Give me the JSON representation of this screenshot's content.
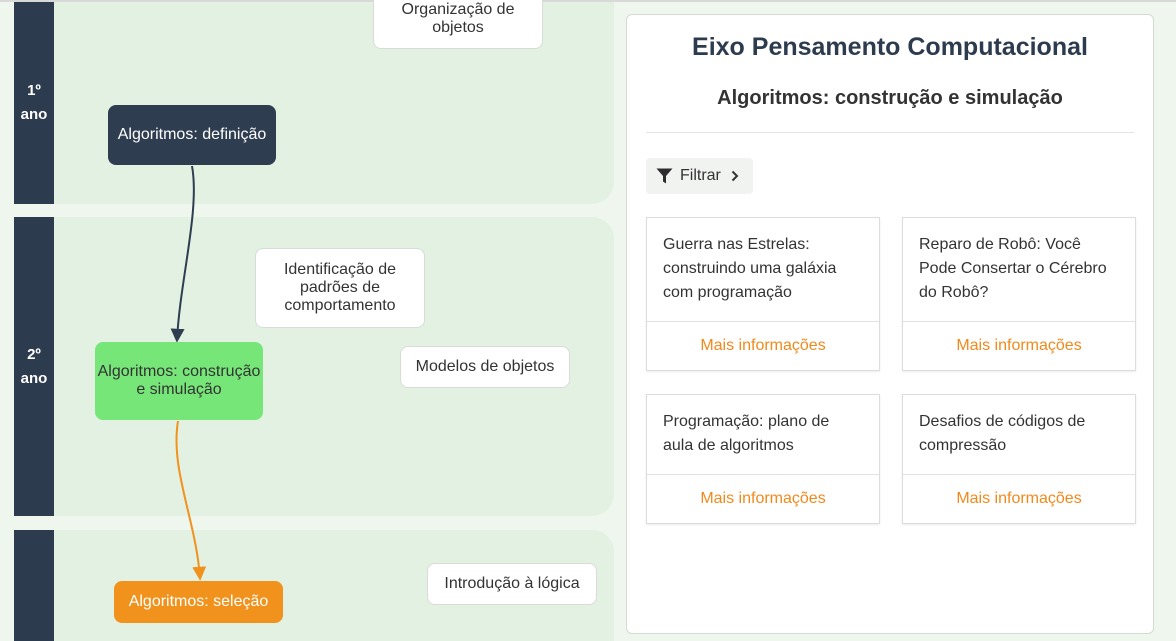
{
  "years": [
    {
      "num": "1º",
      "label": "ano"
    },
    {
      "num": "2º",
      "label": "ano"
    },
    {
      "num": "",
      "label": ""
    }
  ],
  "nodes": {
    "org_objetos": "Organização de objetos",
    "alg_definicao": "Algoritmos: definição",
    "ident_padroes": "Identificação de padrões de comportamento",
    "alg_construcao": "Algoritmos: construção e simulação",
    "modelos_objetos": "Modelos de objetos",
    "alg_selecao": "Algoritmos: seleção",
    "intro_logica": "Introdução à lógica"
  },
  "colors": {
    "dark": "#2f3d50",
    "green": "#77e679",
    "orange": "#f0921c",
    "link": "#ef8a1c"
  },
  "panel": {
    "title": "Eixo Pensamento Computacional",
    "subtitle": "Algoritmos: construção e simulação",
    "filter_label": "Filtrar",
    "filter_icon": "funnel-icon",
    "cards": [
      {
        "text": "Guerra nas Estrelas: construindo uma galáxia com programação",
        "link": "Mais informações"
      },
      {
        "text": "Reparo de Robô: Você Pode Consertar o Cérebro do Robô?",
        "link": "Mais informações"
      },
      {
        "text": "Programação: plano de aula de algoritmos",
        "link": "Mais informações"
      },
      {
        "text": "Desafios de códigos de compressão",
        "link": "Mais informações"
      }
    ]
  }
}
